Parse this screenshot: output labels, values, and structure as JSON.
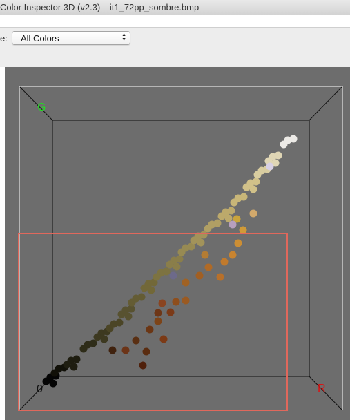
{
  "window": {
    "title": "Color Inspector 3D (v2.3)",
    "filename": "it1_72pp_sombre.bmp"
  },
  "toolbar": {
    "mode_label": "e:",
    "mode_select": {
      "value": "All Colors"
    }
  },
  "viewer": {
    "axis_labels": {
      "g": "G",
      "r": "R",
      "origin": "0"
    },
    "colors": {
      "background": "#6d6d6d",
      "cube_edges": "#ffffff",
      "cube_back_edges": "#111111",
      "selection_box": "#e0685c",
      "g_label": "#22dd22",
      "r_label": "#dd1111"
    }
  }
}
